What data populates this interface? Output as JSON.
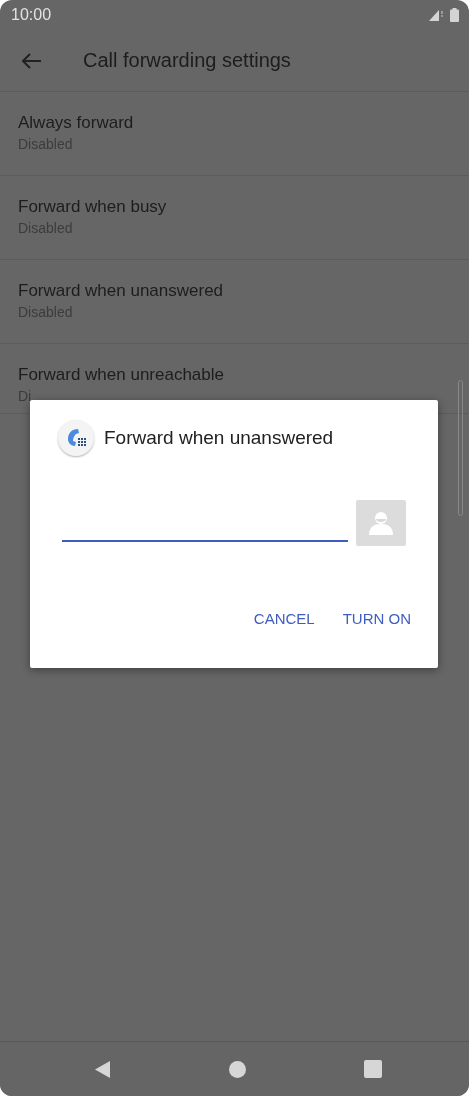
{
  "status_bar": {
    "time": "10:00"
  },
  "toolbar": {
    "title": "Call forwarding settings"
  },
  "settings": [
    {
      "title": "Always forward",
      "subtitle": "Disabled"
    },
    {
      "title": "Forward when busy",
      "subtitle": "Disabled"
    },
    {
      "title": "Forward when unanswered",
      "subtitle": "Disabled"
    },
    {
      "title": "Forward when unreachable",
      "subtitle": "Di"
    }
  ],
  "dialog": {
    "title": "Forward when unanswered",
    "field": {
      "focused": true
    },
    "buttons": [
      "CANCEL",
      "TURN ON"
    ]
  }
}
